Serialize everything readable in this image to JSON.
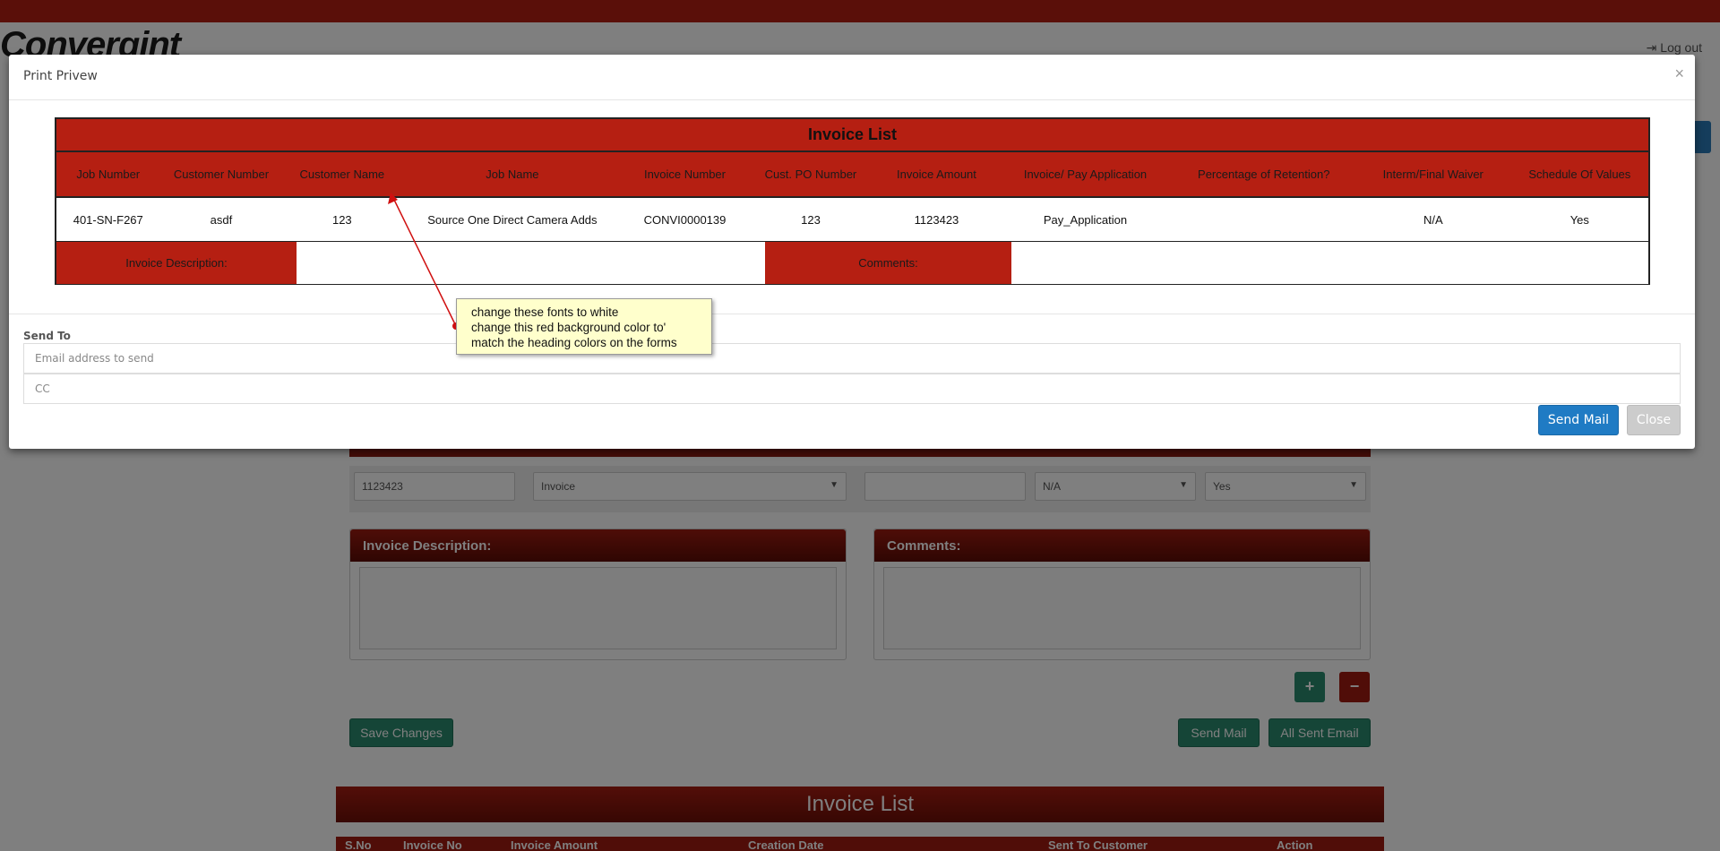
{
  "app": {
    "logo_text": "Convergint",
    "logout_label": "Log out"
  },
  "background_form": {
    "amount_value": "1123423",
    "type_value": "Invoice",
    "blank_value": "",
    "waiver_value": "N/A",
    "sov_value": "Yes",
    "invoice_description_label": "Invoice Description:",
    "comments_label": "Comments:",
    "add_label": "+",
    "remove_label": "−",
    "save_changes_label": "Save Changes",
    "send_mail_label": "Send Mail",
    "all_sent_email_label": "All Sent Email",
    "invoice_list_title": "Invoice List",
    "list_columns": [
      "S.No",
      "Invoice No",
      "Invoice Amount",
      "Creation Date",
      "Sent To Customer",
      "Action"
    ]
  },
  "modal": {
    "title": "Print Privew",
    "close_icon": "×",
    "table_title": "Invoice List",
    "columns": [
      "Job Number",
      "Customer Number",
      "Customer Name",
      "Job Name",
      "Invoice Number",
      "Cust. PO Number",
      "Invoice Amount",
      "Invoice/ Pay Application",
      "Percentage of Retention?",
      "Interm/Final Waiver",
      "Schedule Of Values"
    ],
    "row": [
      "401-SN-F267",
      "asdf",
      "123",
      "Source One Direct Camera Adds",
      "CONVI0000139",
      "123",
      "1123423",
      "Pay_Application",
      "",
      "N/A",
      "Yes"
    ],
    "invoice_description_label": "Invoice Description:",
    "invoice_description_value": "",
    "comments_label": "Comments:",
    "comments_value": "",
    "send_to_label": "Send To",
    "email_placeholder": "Email address to send",
    "cc_placeholder": "CC",
    "send_mail_label": "Send Mail",
    "close_label": "Close"
  },
  "annotation": {
    "line1": "change these fonts to white",
    "line2": "change this red background color to'",
    "line3": "match the heading colors on the forms"
  },
  "colors": {
    "table_red": "#b51f12",
    "heading_gradient_top": "#9c1b10",
    "heading_gradient_bottom": "#5e0c05",
    "primary_blue": "#1f7bc4",
    "green": "#2b8a6e",
    "callout_yellow": "#ffffcc"
  }
}
